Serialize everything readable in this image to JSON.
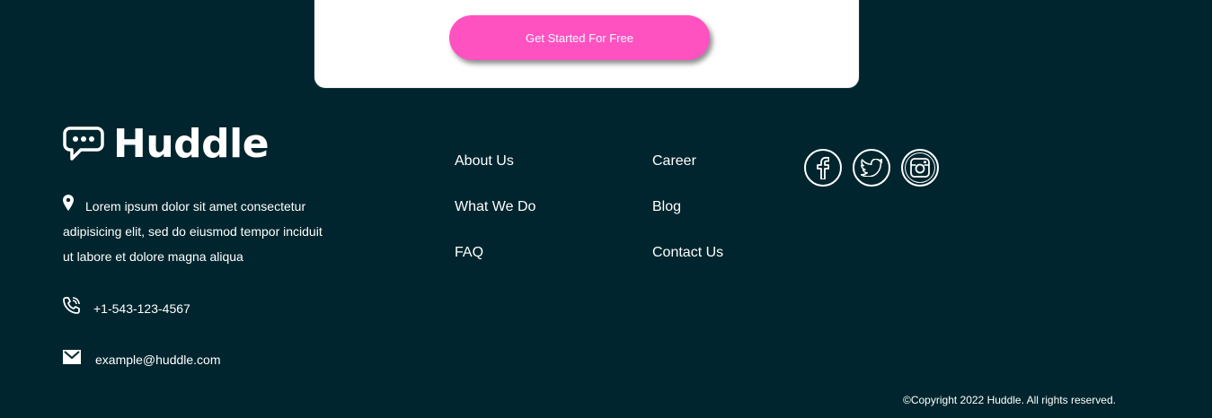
{
  "cta": {
    "button_label": "Get Started For Free"
  },
  "brand": {
    "name": "Huddle"
  },
  "contact": {
    "address": "Lorem ipsum dolor sit amet consectetur adipisicing elit, sed do eiusmod tempor inciduit ut labore et dolore magna aliqua",
    "phone": "+1-543-123-4567",
    "email": "example@huddle.com"
  },
  "links": {
    "col1": [
      "About Us",
      "What We Do",
      "FAQ"
    ],
    "col2": [
      "Career",
      "Blog",
      "Contact Us"
    ]
  },
  "social": [
    "facebook-icon",
    "twitter-icon",
    "instagram-icon"
  ],
  "footer": {
    "copyright": "©Copyright 2022 Huddle. All rights reserved."
  },
  "colors": {
    "background": "#00252e",
    "accent": "#ff52c1",
    "card": "#ffffff",
    "text": "#ffffff"
  }
}
